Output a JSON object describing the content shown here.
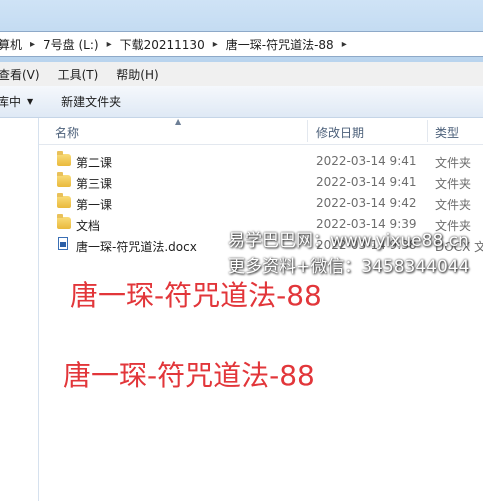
{
  "breadcrumb": {
    "items": [
      "算机",
      "7号盘 (L:)",
      "下载20211130",
      "唐一琛-符咒道法-88"
    ]
  },
  "menu": {
    "items": [
      "查看(V)",
      "工具(T)",
      "帮助(H)"
    ]
  },
  "toolbar": {
    "library": "库中",
    "new_folder": "新建文件夹"
  },
  "columns": {
    "name": "名称",
    "date": "修改日期",
    "type": "类型"
  },
  "files": [
    {
      "name": "第二课",
      "date": "2022-03-14 9:41",
      "type": "文件夹",
      "icon": "folder-icon"
    },
    {
      "name": "第三课",
      "date": "2022-03-14 9:41",
      "type": "文件夹",
      "icon": "folder-icon"
    },
    {
      "name": "第一课",
      "date": "2022-03-14 9:42",
      "type": "文件夹",
      "icon": "folder-icon"
    },
    {
      "name": "文档",
      "date": "2022-03-14 9:39",
      "type": "文件夹",
      "icon": "folder-icon"
    },
    {
      "name": "唐一琛-符咒道法.docx",
      "date": "2022-03-14 9:38",
      "type": "DOCX 文",
      "icon": "docx-icon"
    }
  ],
  "watermark": {
    "line1": "易学巴巴网：www.yixue88.cn",
    "line2": "更多资料+微信：3458344044",
    "title1": "唐一琛-符咒道法-88",
    "title2": "唐一琛-符咒道法-88"
  }
}
